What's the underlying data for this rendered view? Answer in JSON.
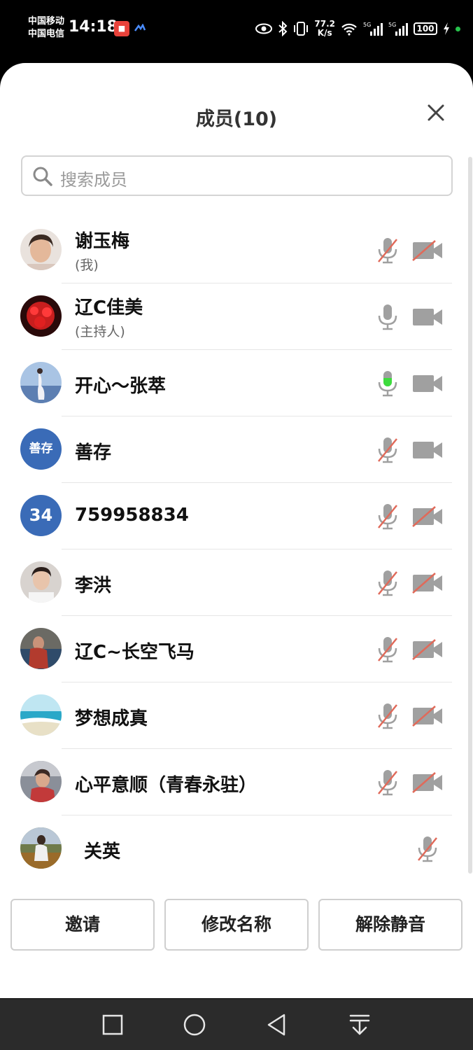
{
  "status_bar": {
    "carrier1": "中国移动",
    "carrier2": "中国电信",
    "time": "14:18",
    "net_speed_value": "77.2",
    "net_speed_unit": "K/s",
    "battery": "100"
  },
  "sheet": {
    "title": "成员(10)",
    "search_placeholder": "搜索成员"
  },
  "members": [
    {
      "name": "谢玉梅",
      "sub": "(我)",
      "mic": "muted",
      "cam": "off",
      "avatar": "photo"
    },
    {
      "name": "辽C佳美",
      "sub": "(主持人)",
      "mic": "on",
      "cam": "on",
      "avatar": "photo"
    },
    {
      "name": "开心～张萃",
      "sub": "",
      "mic": "speaking",
      "cam": "on",
      "avatar": "photo"
    },
    {
      "name": "善存",
      "sub": "",
      "mic": "muted",
      "cam": "on",
      "avatar": "text",
      "avatar_text": "善存"
    },
    {
      "name": "759958834",
      "sub": "",
      "mic": "muted",
      "cam": "off",
      "avatar": "text",
      "avatar_text": "34"
    },
    {
      "name": "李洪",
      "sub": "",
      "mic": "muted",
      "cam": "off",
      "avatar": "photo"
    },
    {
      "name": "辽C~长空飞马",
      "sub": "",
      "mic": "muted",
      "cam": "off",
      "avatar": "photo"
    },
    {
      "name": "梦想成真",
      "sub": "",
      "mic": "muted",
      "cam": "off",
      "avatar": "photo"
    },
    {
      "name": "心平意顺（青春永驻）",
      "sub": "",
      "mic": "muted",
      "cam": "off",
      "avatar": "photo"
    },
    {
      "name": "关英",
      "sub": "",
      "mic": "muted",
      "cam": "none",
      "avatar": "photo"
    }
  ],
  "actions": {
    "invite": "邀请",
    "rename": "修改名称",
    "unmute": "解除静音"
  },
  "colors": {
    "icon_gray": "#9a9a9a",
    "mute_slash": "#e06a5a",
    "speaking": "#3ddc3d",
    "avatar_blue": "#3a6bb7"
  }
}
